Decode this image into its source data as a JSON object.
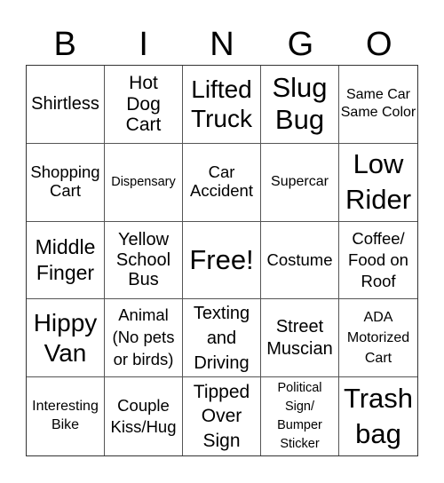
{
  "header": [
    "B",
    "I",
    "N",
    "G",
    "O"
  ],
  "cells": [
    "Shirtless",
    "Hot Dog Cart",
    "Lifted Truck",
    "Slug Bug",
    "Same Car Same Color",
    "Shopping Cart",
    "Dispensary",
    "Car Accident",
    "Supercar",
    "Low Rider",
    "Middle Finger",
    "Yellow School Bus",
    "Free!",
    "Costume",
    "Coffee/ Food on Roof",
    "Hippy Van",
    "Animal (No pets or birds)",
    "Texting and Driving",
    "Street Muscian",
    "ADA Motorized Cart",
    "Interesting Bike",
    "Couple Kiss/Hug",
    "Tipped Over Sign",
    "Political Sign/ Bumper Sticker",
    "Trash bag"
  ]
}
